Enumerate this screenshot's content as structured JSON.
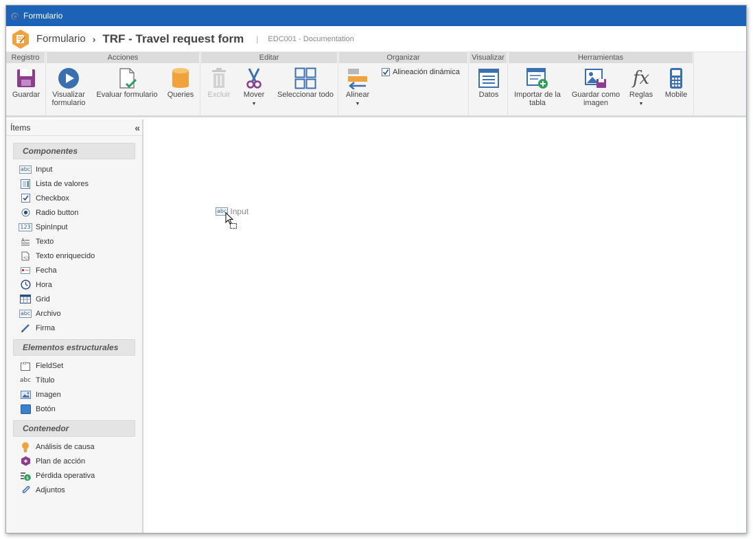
{
  "window": {
    "title": "Formulario"
  },
  "header": {
    "breadcrumb": "Formulario",
    "separator": "›",
    "title": "TRF - Travel request form",
    "pipe": "|",
    "subtitle": "EDC001 - Documentation"
  },
  "ribbon": {
    "groups": {
      "registro": "Registro",
      "acciones": "Acciones",
      "editar": "Editar",
      "organizar": "Organizar",
      "visualizar": "Visualizar",
      "herramientas": "Herramientas"
    },
    "buttons": {
      "guardar": "Guardar",
      "visualizar_1": "Visualizar",
      "visualizar_2": "formulario",
      "evaluar": "Evaluar formulario",
      "queries": "Queries",
      "excluir": "Excluir",
      "mover": "Mover",
      "seleccionar": "Seleccionar todo",
      "alinear": "Alinear",
      "datos": "Datos",
      "importar_1": "Importar de la",
      "importar_2": "tabla",
      "guardar_img_1": "Guardar como",
      "guardar_img_2": "imagen",
      "reglas": "Reglas",
      "mobile": "Mobile"
    },
    "dynamic_align": {
      "label": "Alineación dinámica",
      "checked": true
    }
  },
  "sidebar": {
    "title": "Ítems",
    "sections": {
      "componentes": "Componentes",
      "estructurales": "Elementos estructurales",
      "contenedor": "Contenedor"
    },
    "componentes": [
      "Input",
      "Lista de valores",
      "Checkbox",
      "Radio button",
      "SpinInput",
      "Texto",
      "Texto enriquecido",
      "Fecha",
      "Hora",
      "Grid",
      "Archivo",
      "Firma"
    ],
    "estructurales": [
      "FieldSet",
      "Título",
      "Imagen",
      "Botón"
    ],
    "contenedor": [
      "Análisis de causa",
      "Plan de acción",
      "Pérdida operativa",
      "Adjuntos"
    ]
  },
  "canvas": {
    "drag_label": "Input",
    "abc": "abc"
  },
  "colors": {
    "titlebar": "#1c63b8",
    "accent": "#3a6fb0",
    "purple": "#8a3e8c",
    "orange": "#f0a23c"
  }
}
